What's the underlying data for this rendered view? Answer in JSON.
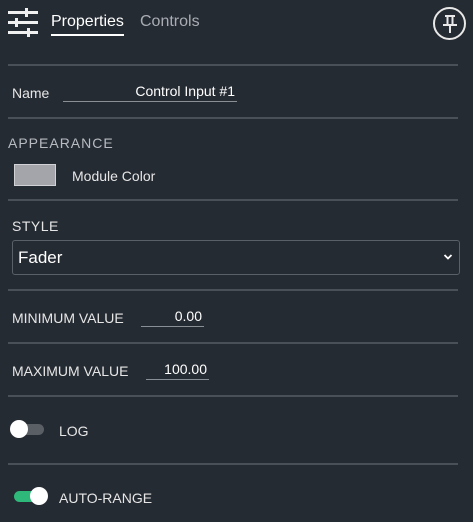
{
  "header": {
    "tabs": [
      {
        "label": "Properties",
        "active": true
      },
      {
        "label": "Controls",
        "active": false
      }
    ],
    "icons": {
      "menu": "sliders-icon",
      "pin": "pin-icon"
    }
  },
  "name_field": {
    "label": "Name",
    "value": "Control Input #1"
  },
  "appearance": {
    "title": "APPEARANCE",
    "module_color": {
      "label": "Module Color",
      "color": "#a3a5aa"
    }
  },
  "style": {
    "title": "STYLE",
    "selected": "Fader"
  },
  "minimum": {
    "label": "MINIMUM VALUE",
    "value": "0.00"
  },
  "maximum": {
    "label": "MAXIMUM VALUE",
    "value": "100.00"
  },
  "log_toggle": {
    "label": "LOG",
    "on": false
  },
  "auto_range_toggle": {
    "label": "AUTO-RANGE",
    "on": true
  },
  "colors": {
    "background": "#252b33",
    "accent_on": "#2eb87a",
    "track_off": "#5a5f66"
  }
}
